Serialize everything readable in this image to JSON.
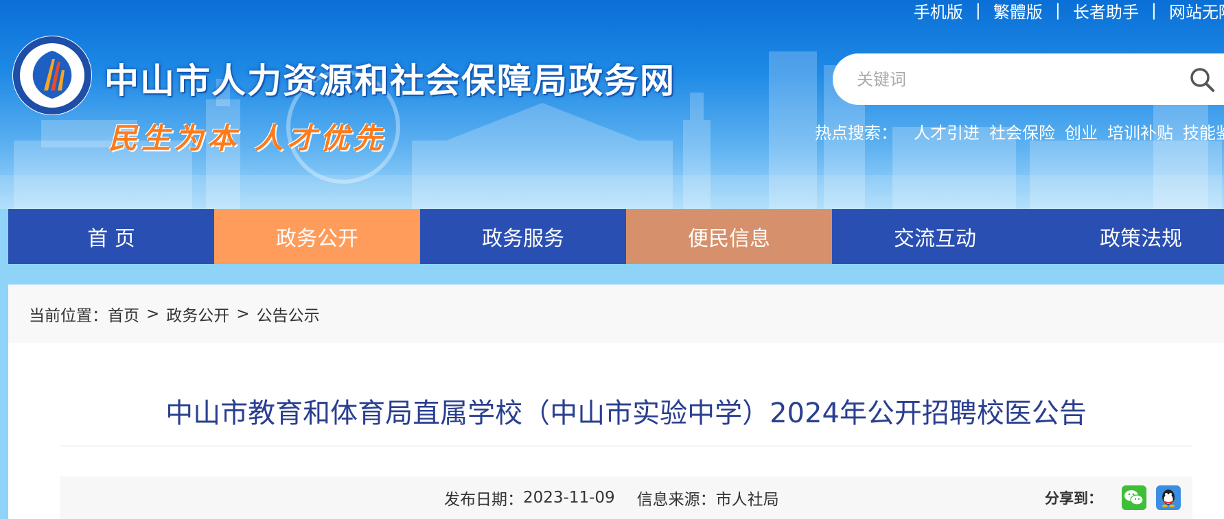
{
  "header": {
    "site_title": "中山市人力资源和社会保障局政务网",
    "slogan": "民生为本 人才优先",
    "top_links": [
      "手机版",
      "繁體版",
      "长者助手",
      "网站无障碍"
    ],
    "top_links_separator": "|",
    "search": {
      "placeholder": "关键词",
      "icon": "search-icon"
    },
    "hot_search": {
      "label": "热点搜索：",
      "keywords": [
        "人才引进",
        "社会保险",
        "创业",
        "培训补贴",
        "技能鉴定"
      ]
    }
  },
  "nav": {
    "items": [
      {
        "label": "首 页",
        "color": "#2a4fb3"
      },
      {
        "label": "政务公开",
        "color": "#ff9c5b"
      },
      {
        "label": "政务服务",
        "color": "#2a4fb3"
      },
      {
        "label": "便民信息",
        "color": "#d6906b"
      },
      {
        "label": "交流互动",
        "color": "#2a4fb3"
      },
      {
        "label": "政策法规",
        "color": "#2a4fb3"
      }
    ]
  },
  "breadcrumb": {
    "prefix": "当前位置：",
    "items": [
      "首页",
      "政务公开",
      "公告公示"
    ],
    "separator": ">"
  },
  "article": {
    "title": "中山市教育和体育局直属学校（中山市实验中学）2024年公开招聘校医公告",
    "publish_label": "发布日期：",
    "publish_date": "2023-11-09",
    "source_label": "信息来源：",
    "source": "市人社局",
    "share_label": "分享到：",
    "share_icons": [
      "wechat-icon",
      "qq-icon"
    ]
  },
  "colors": {
    "title_blue": "#2a3f8f",
    "nav_blue": "#2a4fb3",
    "slogan_orange": "#ff7a1a"
  }
}
